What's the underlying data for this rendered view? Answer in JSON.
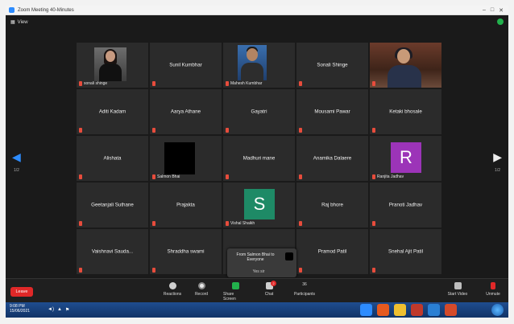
{
  "window": {
    "title": "Zoom Meeting 40-Minutes"
  },
  "meeting": {
    "view_label": "View"
  },
  "pagination": {
    "left": "1/2",
    "right": "1/2"
  },
  "tiles": [
    {
      "id": "r1c1",
      "label": "sonali shinge",
      "kind": "photo-woman"
    },
    {
      "id": "r1c2",
      "label": "Sunil Kumbhar",
      "kind": "name"
    },
    {
      "id": "r1c3",
      "label": "Mahesh Kumbhar",
      "kind": "photo-man"
    },
    {
      "id": "r1c4",
      "label": "Sonali Shinge",
      "kind": "name"
    },
    {
      "id": "r1c5",
      "label": "",
      "kind": "video-woman"
    },
    {
      "id": "r2c1",
      "label": "Aditi Kadam",
      "kind": "name"
    },
    {
      "id": "r2c2",
      "label": "Aarya Athane",
      "kind": "name"
    },
    {
      "id": "r2c3",
      "label": "Gayatri",
      "kind": "name"
    },
    {
      "id": "r2c4",
      "label": "Mousami Pawar",
      "kind": "name"
    },
    {
      "id": "r2c5",
      "label": "Ketaki bhosale",
      "kind": "name"
    },
    {
      "id": "r3c1",
      "label": "Alishata",
      "kind": "name"
    },
    {
      "id": "r3c2",
      "label": "Salmon Bhai",
      "kind": "black"
    },
    {
      "id": "r3c3",
      "label": "Madhuri mane",
      "kind": "name"
    },
    {
      "id": "r3c4",
      "label": "Anamika Dalaere",
      "kind": "name"
    },
    {
      "id": "r3c5",
      "label": "Ranjita Jadhav",
      "kind": "letter",
      "letter": "R",
      "color": "#9c34b8"
    },
    {
      "id": "r4c1",
      "label": "Geetanjali Suthane",
      "kind": "name"
    },
    {
      "id": "r4c2",
      "label": "Prajakta",
      "kind": "name"
    },
    {
      "id": "r4c3",
      "label": "Vishal Shaikh",
      "kind": "letter",
      "letter": "S",
      "color": "#1e8a66"
    },
    {
      "id": "r4c4",
      "label": "Raj bhore",
      "kind": "name"
    },
    {
      "id": "r4c5",
      "label": "Pranoti Jadhav",
      "kind": "name"
    },
    {
      "id": "r5c1",
      "label": "Vaishnavi  Sauda...",
      "kind": "name"
    },
    {
      "id": "r5c2",
      "label": "Shraddha swami",
      "kind": "name"
    },
    {
      "id": "r5c3",
      "label": "",
      "kind": "empty"
    },
    {
      "id": "r5c4",
      "label": "Pramod Patil",
      "kind": "name"
    },
    {
      "id": "r5c5",
      "label": "Snehal Ajit Patil",
      "kind": "name"
    }
  ],
  "chat_popup": {
    "from": "From Salmon Bhai to Everyone",
    "message": "Yes sir"
  },
  "toolbar": {
    "leave": "Leave",
    "reactions": "Reactions",
    "record": "Record",
    "share": "Share Screen",
    "chat": "Chat",
    "chat_badge": "2",
    "participants": "Participants",
    "participants_count": "36",
    "start_video": "Start Video",
    "unmute": "Unmute"
  },
  "taskbar": {
    "time": "9:08 PM",
    "date": "15/06/2021"
  },
  "colors": {
    "accent": "#2d8cff",
    "leave": "#e02828",
    "share": "#22b14c"
  }
}
